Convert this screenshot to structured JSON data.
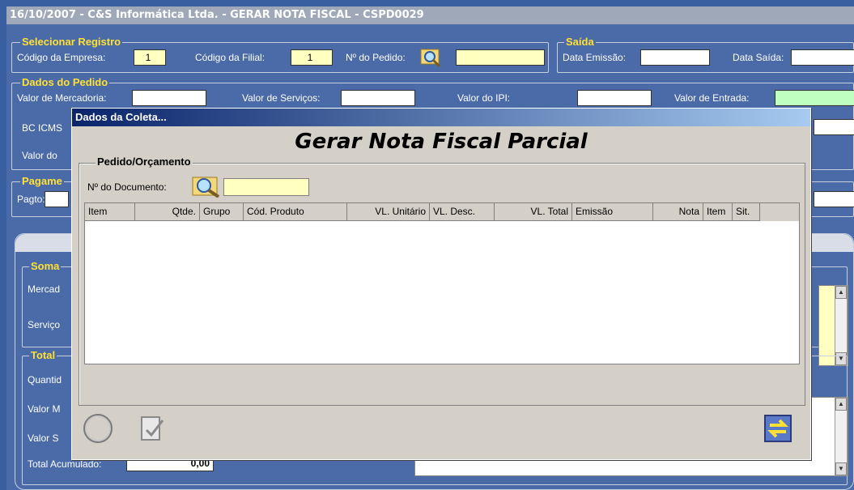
{
  "window": {
    "title": "16/10/2007 - C&S Informática Ltda. - GERAR NOTA FISCAL - CSPD0029"
  },
  "selecionar": {
    "legend": "Selecionar Registro",
    "empresa_label": "Código da Empresa:",
    "empresa_value": "1",
    "filial_label": "Código da Filial:",
    "filial_value": "1",
    "pedido_label": "Nº do Pedido:",
    "pedido_value": ""
  },
  "saida": {
    "legend": "Saída",
    "emissao_label": "Data Emissão:",
    "saida_label": "Data Saída:"
  },
  "dados_pedido": {
    "legend": "Dados do Pedido",
    "valor_merc_label": "Valor de Mercadoria:",
    "valor_serv_label": "Valor de Serviços:",
    "valor_ipi_label": "Valor do IPI:",
    "valor_entrada_label": "Valor de Entrada:",
    "bc_icms_label": "BC ICMS",
    "valor_do_label": "Valor do"
  },
  "pagamento": {
    "legend": "Pagame",
    "pagto_label": "Pagto:"
  },
  "soma": {
    "legend": "Soma",
    "merc_label": "Mercad",
    "serv_label": "Serviço"
  },
  "total": {
    "legend": "Total",
    "quant_label": "Quantid",
    "valor_m_label": "Valor M",
    "valor_s_label": "Valor S",
    "acumulado_label": "Total Acumulado:",
    "acumulado_value": "0,00"
  },
  "dialog": {
    "title": "Dados da Coleta...",
    "heading": "Gerar Nota Fiscal Parcial",
    "group_legend": "Pedido/Orçamento",
    "doc_label": "Nº do Documento:",
    "doc_value": "",
    "columns": [
      "Item",
      "Qtde.",
      "Grupo",
      "Cód. Produto",
      "VL. Unitário",
      "VL. Desc.",
      "VL. Total",
      "Emissão",
      "Nota",
      "Item",
      "Sit."
    ]
  },
  "colors": {
    "title_bg": "#0a246a",
    "panel": "#4a6ba8",
    "legend": "#ffe033",
    "input_yellow": "#ffffc0"
  }
}
